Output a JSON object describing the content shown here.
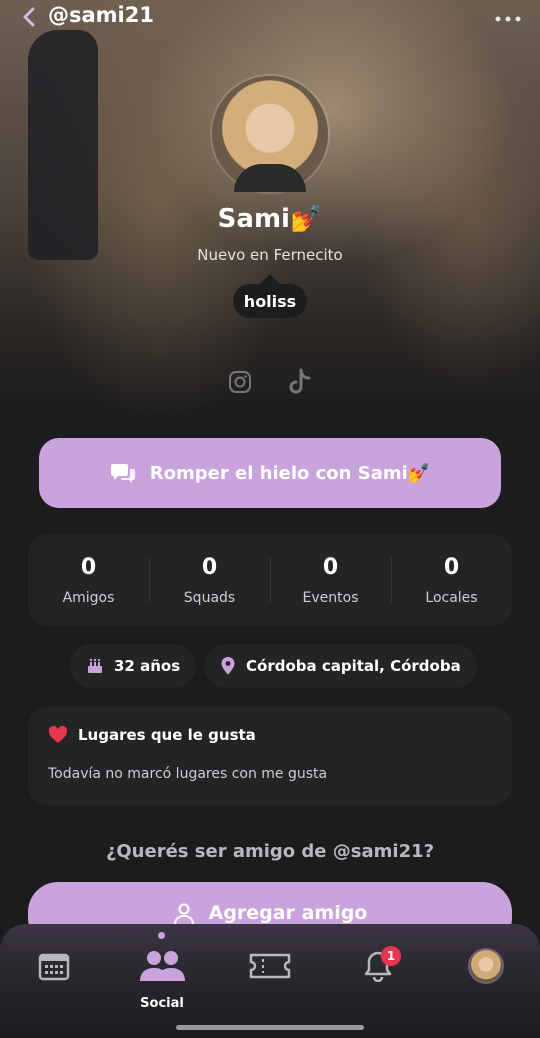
{
  "header": {
    "username": "@sami21"
  },
  "profile": {
    "display_name": "Sami💅",
    "subtitle": "Nuevo en Fernecito",
    "status": "holiss"
  },
  "cta": {
    "label": "Romper el hielo con Sami💅"
  },
  "stats": [
    {
      "value": "0",
      "label": "Amigos"
    },
    {
      "value": "0",
      "label": "Squads"
    },
    {
      "value": "0",
      "label": "Eventos"
    },
    {
      "value": "0",
      "label": "Locales"
    }
  ],
  "info": {
    "age": "32 años",
    "location": "Córdoba capital, Córdoba"
  },
  "likes": {
    "title": "Lugares que le gusta",
    "empty": "Todavía no marcó lugares con me gusta"
  },
  "friend": {
    "question": "¿Querés ser amigo de @sami21?",
    "button": "Agregar amigo"
  },
  "nav": {
    "active_label": "Social",
    "notifications_count": "1"
  },
  "colors": {
    "accent": "#c9a4dc",
    "background": "#1c1b1d",
    "card": "#242326",
    "heart": "#e8364f"
  }
}
